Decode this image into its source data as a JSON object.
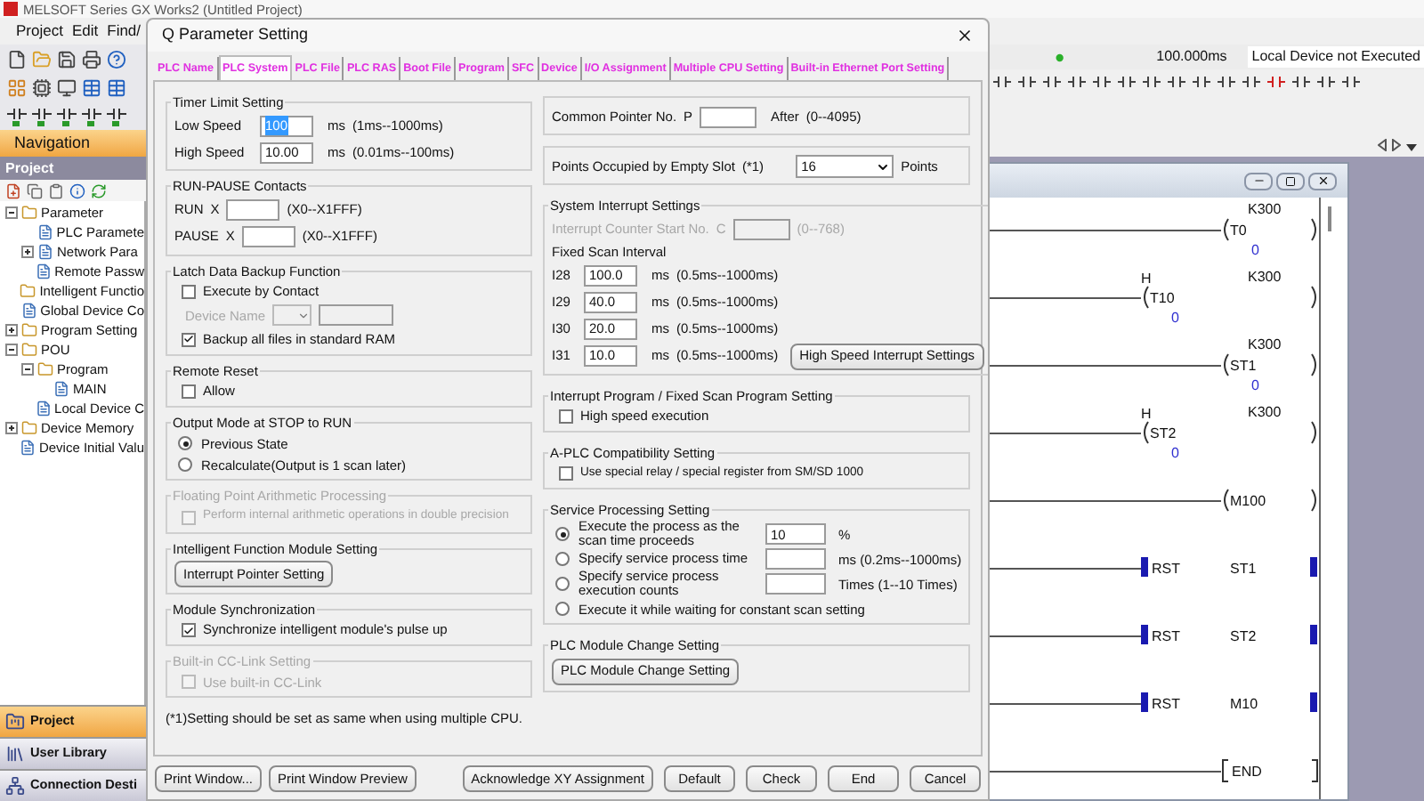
{
  "app": {
    "title": "MELSOFT Series GX Works2 (Untitled Project)",
    "menu": [
      "Project",
      "Edit",
      "Find/"
    ],
    "status": {
      "scan_time": "100.000ms",
      "local_device": "Local Device not Executed"
    },
    "navigation": {
      "title": "Navigation",
      "panel_title": "Project",
      "tree": [
        {
          "label": "Parameter",
          "kind": "folder",
          "expanded": true,
          "children": [
            {
              "label": "PLC Paramete",
              "kind": "document"
            },
            {
              "label": "Network Para",
              "kind": "document",
              "expanded": false
            },
            {
              "label": "Remote Passw",
              "kind": "document"
            }
          ]
        },
        {
          "label": "Intelligent Functio",
          "kind": "folder"
        },
        {
          "label": "Global Device Co",
          "kind": "document"
        },
        {
          "label": "Program Setting",
          "kind": "folder",
          "expanded": false
        },
        {
          "label": "POU",
          "kind": "folder",
          "expanded": true,
          "children": [
            {
              "label": "Program",
              "kind": "folder",
              "expanded": true,
              "children": [
                {
                  "label": "MAIN",
                  "kind": "document"
                }
              ]
            },
            {
              "label": "Local Device C",
              "kind": "document"
            }
          ]
        },
        {
          "label": "Device Memory",
          "kind": "folder",
          "expanded": false
        },
        {
          "label": "Device Initial Valu",
          "kind": "document"
        }
      ],
      "buttons": [
        {
          "label": "Project",
          "kind": "project",
          "selected": true
        },
        {
          "label": "User Library",
          "kind": "library",
          "selected": false
        },
        {
          "label": "Connection Desti",
          "kind": "connection",
          "selected": false
        }
      ]
    },
    "ladder": {
      "rungs": [
        {
          "kind": "coil",
          "name": "T0",
          "setting": "K300",
          "current": "0"
        },
        {
          "kind": "coil",
          "prefix": "H",
          "name": "T10",
          "setting": "K300",
          "current": "0"
        },
        {
          "kind": "coil",
          "name": "ST1",
          "setting": "K300",
          "current": "0"
        },
        {
          "kind": "coil",
          "prefix": "H",
          "name": "ST2",
          "setting": "K300",
          "current": "0"
        },
        {
          "kind": "coil",
          "name": "M100"
        },
        {
          "kind": "rst",
          "name": "RST",
          "operand": "ST1"
        },
        {
          "kind": "rst",
          "name": "RST",
          "operand": "ST2"
        },
        {
          "kind": "rst",
          "name": "RST",
          "operand": "M10"
        },
        {
          "kind": "end",
          "name": "END"
        }
      ]
    }
  },
  "dialog": {
    "title": "Q Parameter Setting",
    "tabs": [
      {
        "label": "PLC Name",
        "selected": false
      },
      {
        "label": "PLC System",
        "selected": true
      },
      {
        "label": "PLC File",
        "selected": false
      },
      {
        "label": "PLC RAS",
        "selected": false
      },
      {
        "label": "Boot File",
        "selected": false
      },
      {
        "label": "Program",
        "selected": false
      },
      {
        "label": "SFC",
        "selected": false
      },
      {
        "label": "Device",
        "selected": false
      },
      {
        "label": "I/O Assignment",
        "selected": false
      },
      {
        "label": "Multiple CPU Setting",
        "selected": false
      },
      {
        "label": "Built-in Ethernet Port Setting",
        "selected": false
      }
    ],
    "left_groups": [
      {
        "title": "Timer Limit Setting",
        "items": [
          {
            "kind": "field",
            "label": "Low Speed",
            "value": "100",
            "text_selected": true,
            "unit": "ms",
            "range": "(1ms--1000ms)"
          },
          {
            "kind": "field",
            "label": "High Speed",
            "value": "10.00",
            "text_selected": false,
            "unit": "ms",
            "range": "(0.01ms--100ms)"
          }
        ]
      },
      {
        "title": "RUN-PAUSE Contacts",
        "items": [
          {
            "kind": "field",
            "label": "RUN",
            "prefix": "X",
            "range": "(X0--X1FFF)"
          },
          {
            "kind": "field",
            "label": "PAUSE",
            "prefix": "X",
            "range": "(X0--X1FFF)"
          }
        ]
      },
      {
        "title": "Latch Data Backup Function",
        "items": [
          {
            "kind": "checkbox",
            "label": "Execute by Contact",
            "checked": false
          },
          {
            "kind": "device_select",
            "label": "Device Name",
            "disabled": true
          },
          {
            "kind": "checkbox",
            "label": "Backup all files in standard RAM",
            "checked": true
          }
        ]
      },
      {
        "title": "Remote Reset",
        "items": [
          {
            "kind": "checkbox",
            "label": "Allow",
            "checked": false
          }
        ]
      },
      {
        "title": "Output Mode at STOP to RUN",
        "items": [
          {
            "kind": "radio",
            "label": "Previous State",
            "selected": true
          },
          {
            "kind": "radio",
            "label": "Recalculate(Output is 1 scan later)",
            "selected": false
          }
        ]
      },
      {
        "title": "Floating Point Arithmetic Processing",
        "disabled": true,
        "items": [
          {
            "kind": "checkbox",
            "label": "Perform internal arithmetic operations in double precision",
            "checked": false
          }
        ]
      },
      {
        "title": "Intelligent Function Module Setting",
        "items": [
          {
            "kind": "button",
            "label": "Interrupt Pointer Setting"
          }
        ]
      },
      {
        "title": "Module Synchronization",
        "items": [
          {
            "kind": "checkbox",
            "label": "Synchronize intelligent module's pulse up",
            "checked": true
          }
        ]
      },
      {
        "title": "Built-in CC-Link Setting",
        "disabled": true,
        "items": [
          {
            "kind": "checkbox",
            "label": "Use built-in CC-Link",
            "checked": false
          }
        ]
      }
    ],
    "footnote": "(*1)Setting should be set as same when using multiple CPU.",
    "right_groups": [
      {
        "items": [
          {
            "kind": "field",
            "label": "Common Pointer No.",
            "prefix": "P",
            "unit": "After",
            "range": "(0--4095)"
          }
        ]
      },
      {
        "items": [
          {
            "kind": "select",
            "label": "Points Occupied by Empty Slot",
            "note": "(*1)",
            "value": "16",
            "unit": "Points"
          }
        ]
      },
      {
        "title": "System Interrupt Settings",
        "items": [
          {
            "kind": "field",
            "label": "Interrupt Counter Start No.",
            "prefix": "C",
            "range": "(0--768)",
            "disabled": true
          },
          {
            "kind": "text",
            "label": "Fixed Scan Interval"
          },
          {
            "kind": "field",
            "label": "I28",
            "value": "100.0",
            "unit": "ms",
            "range": "(0.5ms--1000ms)"
          },
          {
            "kind": "field",
            "label": "I29",
            "value": "40.0",
            "unit": "ms",
            "range": "(0.5ms--1000ms)"
          },
          {
            "kind": "field",
            "label": "I30",
            "value": "20.0",
            "unit": "ms",
            "range": "(0.5ms--1000ms)"
          },
          {
            "kind": "field",
            "label": "I31",
            "value": "10.0",
            "unit": "ms",
            "range": "(0.5ms--1000ms)",
            "button": "High Speed Interrupt Settings"
          }
        ]
      },
      {
        "title": "Interrupt Program / Fixed Scan Program Setting",
        "items": [
          {
            "kind": "checkbox",
            "label": "High speed execution",
            "checked": false
          }
        ]
      },
      {
        "title": "A-PLC Compatibility Setting",
        "items": [
          {
            "kind": "checkbox",
            "label": "Use special relay / special register from SM/SD 1000",
            "checked": false
          }
        ]
      },
      {
        "title": "Service Processing Setting",
        "items": [
          {
            "kind": "radio",
            "label": "Execute the process as the scan time proceeds",
            "selected": true,
            "field": true,
            "value": "10",
            "unit": "%"
          },
          {
            "kind": "radio",
            "label": "Specify service process time",
            "selected": false,
            "field": true,
            "unit": "ms (0.2ms--1000ms)"
          },
          {
            "kind": "radio",
            "label": "Specify service process execution counts",
            "selected": false,
            "field": true,
            "unit": "Times (1--10 Times)"
          },
          {
            "kind": "radio",
            "label": "Execute it while waiting for constant scan setting",
            "selected": false
          }
        ]
      },
      {
        "title": "PLC Module Change Setting",
        "items": [
          {
            "kind": "button",
            "label": "PLC Module Change Setting"
          }
        ]
      }
    ],
    "buttons_left": [
      "Print Window...",
      "Print Window Preview"
    ],
    "buttons_right": [
      "Acknowledge XY Assignment",
      "Default",
      "Check",
      "End",
      "Cancel"
    ]
  }
}
